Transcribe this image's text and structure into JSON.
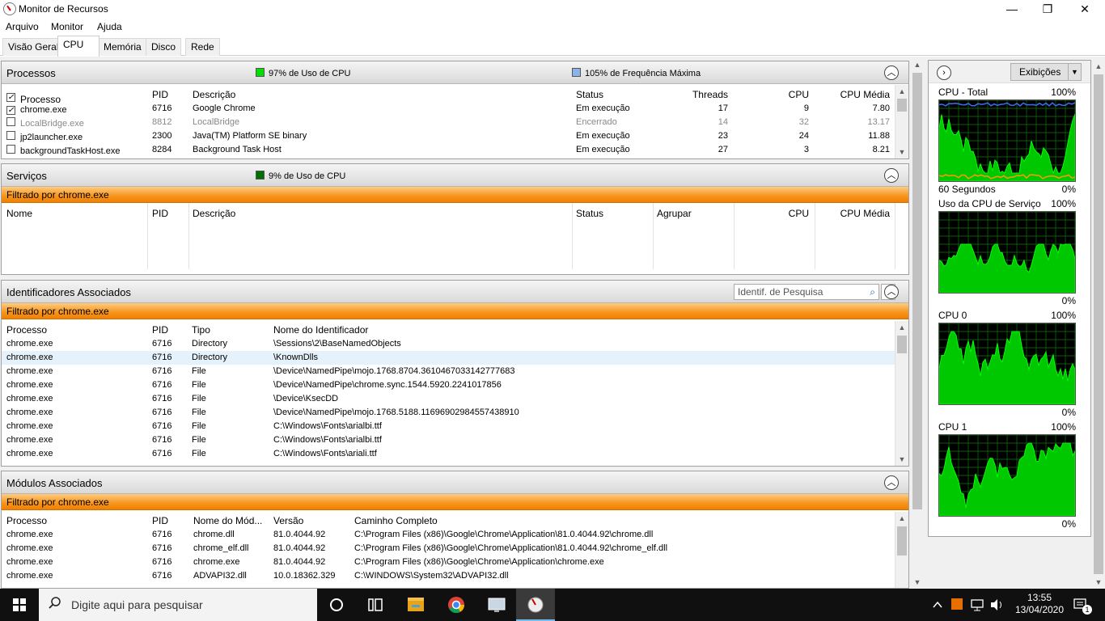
{
  "window": {
    "title": "Monitor de Recursos",
    "controls": {
      "minimize": "—",
      "maximize": "❐",
      "close": "✕"
    }
  },
  "menu": [
    "Arquivo",
    "Monitor",
    "Ajuda"
  ],
  "tabs": [
    "Visão Geral",
    "CPU",
    "Memória",
    "Disco",
    "Rede"
  ],
  "active_tab": "CPU",
  "processes": {
    "title": "Processos",
    "legend_cpu": "97% de Uso de CPU",
    "legend_freq": "105% de Frequência Máxima",
    "legend_cpu_color": "#00e000",
    "legend_freq_color": "#8ab4e8",
    "columns": [
      "Processo",
      "PID",
      "Descrição",
      "Status",
      "Threads",
      "CPU",
      "CPU Média"
    ],
    "rows": [
      {
        "checked": true,
        "name": "chrome.exe",
        "pid": "6716",
        "desc": "Google Chrome",
        "status": "Em execução",
        "threads": "17",
        "cpu": "9",
        "avg": "7.80",
        "ended": false
      },
      {
        "checked": false,
        "name": "LocalBridge.exe",
        "pid": "8812",
        "desc": "LocalBridge",
        "status": "Encerrado",
        "threads": "14",
        "cpu": "32",
        "avg": "13.17",
        "ended": true
      },
      {
        "checked": false,
        "name": "jp2launcher.exe",
        "pid": "2300",
        "desc": "Java(TM) Platform SE binary",
        "status": "Em execução",
        "threads": "23",
        "cpu": "24",
        "avg": "11.88",
        "ended": false
      },
      {
        "checked": false,
        "name": "backgroundTaskHost.exe",
        "pid": "8284",
        "desc": "Background Task Host",
        "status": "Em execução",
        "threads": "27",
        "cpu": "3",
        "avg": "8.21",
        "ended": false
      }
    ]
  },
  "services": {
    "title": "Serviços",
    "legend_cpu": "9% de Uso de CPU",
    "filter": "Filtrado por chrome.exe",
    "columns": [
      "Nome",
      "PID",
      "Descrição",
      "Status",
      "Agrupar",
      "CPU",
      "CPU Média"
    ]
  },
  "handles": {
    "title": "Identificadores Associados",
    "search_placeholder": "Identif. de Pesquisa",
    "filter": "Filtrado por chrome.exe",
    "columns": [
      "Processo",
      "PID",
      "Tipo",
      "Nome do Identificador"
    ],
    "rows": [
      [
        "chrome.exe",
        "6716",
        "Directory",
        "\\Sessions\\2\\BaseNamedObjects"
      ],
      [
        "chrome.exe",
        "6716",
        "Directory",
        "\\KnownDlls"
      ],
      [
        "chrome.exe",
        "6716",
        "File",
        "\\Device\\NamedPipe\\mojo.1768.8704.3610467033142777683"
      ],
      [
        "chrome.exe",
        "6716",
        "File",
        "\\Device\\NamedPipe\\chrome.sync.1544.5920.2241017856"
      ],
      [
        "chrome.exe",
        "6716",
        "File",
        "\\Device\\KsecDD"
      ],
      [
        "chrome.exe",
        "6716",
        "File",
        "\\Device\\NamedPipe\\mojo.1768.5188.11696902984557438910"
      ],
      [
        "chrome.exe",
        "6716",
        "File",
        "C:\\Windows\\Fonts\\arialbi.ttf"
      ],
      [
        "chrome.exe",
        "6716",
        "File",
        "C:\\Windows\\Fonts\\arialbi.ttf"
      ],
      [
        "chrome.exe",
        "6716",
        "File",
        "C:\\Windows\\Fonts\\ariali.ttf"
      ]
    ]
  },
  "modules": {
    "title": "Módulos Associados",
    "filter": "Filtrado por chrome.exe",
    "columns": [
      "Processo",
      "PID",
      "Nome do Mód...",
      "Versão",
      "Caminho Completo"
    ],
    "rows": [
      [
        "chrome.exe",
        "6716",
        "chrome.dll",
        "81.0.4044.92",
        "C:\\Program Files (x86)\\Google\\Chrome\\Application\\81.0.4044.92\\chrome.dll"
      ],
      [
        "chrome.exe",
        "6716",
        "chrome_elf.dll",
        "81.0.4044.92",
        "C:\\Program Files (x86)\\Google\\Chrome\\Application\\81.0.4044.92\\chrome_elf.dll"
      ],
      [
        "chrome.exe",
        "6716",
        "chrome.exe",
        "81.0.4044.92",
        "C:\\Program Files (x86)\\Google\\Chrome\\Application\\chrome.exe"
      ],
      [
        "chrome.exe",
        "6716",
        "ADVAPI32.dll",
        "10.0.18362.329",
        "C:\\WINDOWS\\System32\\ADVAPI32.dll"
      ]
    ]
  },
  "side": {
    "views_button": "Exibições",
    "graphs": [
      {
        "title": "CPU - Total",
        "max": "100%",
        "bottom_left": "60 Segundos",
        "bottom_right": "0%"
      },
      {
        "title": "Uso da CPU de Serviço",
        "max": "100%",
        "bottom_left": "",
        "bottom_right": "0%"
      },
      {
        "title": "CPU 0",
        "max": "100%",
        "bottom_left": "",
        "bottom_right": "0%"
      },
      {
        "title": "CPU 1",
        "max": "100%",
        "bottom_left": "",
        "bottom_right": "0%"
      }
    ]
  },
  "taskbar": {
    "search_placeholder": "Digite aqui para pesquisar",
    "time": "13:55",
    "date": "13/04/2020",
    "notification_count": "1"
  }
}
